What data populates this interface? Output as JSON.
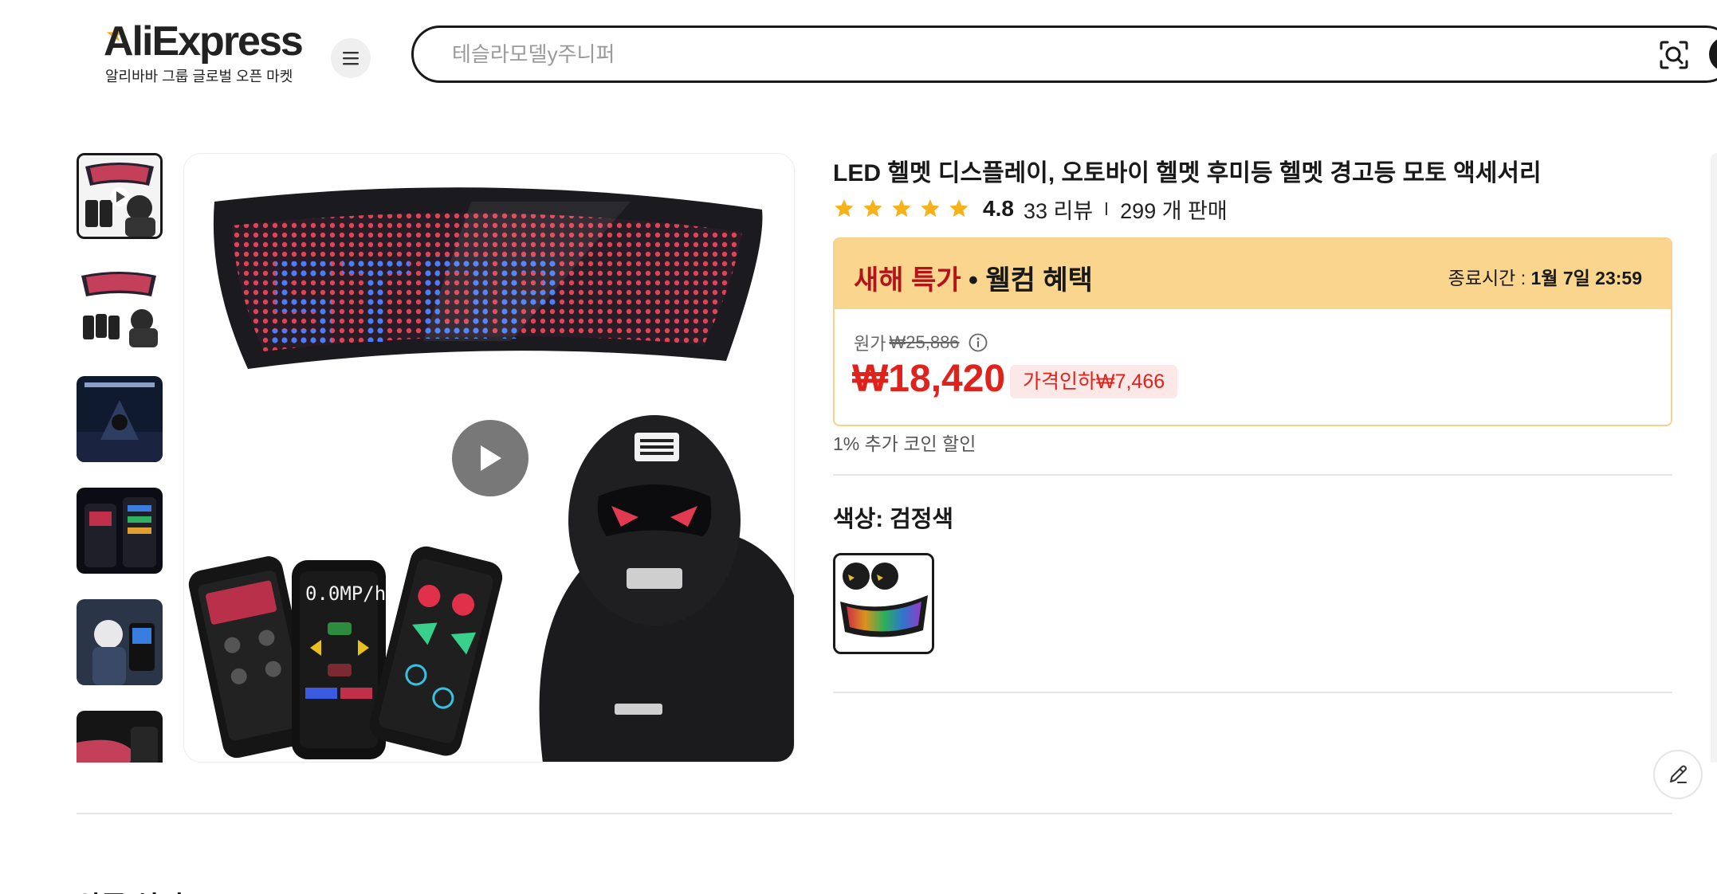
{
  "header": {
    "logo_text": "AliExpress",
    "logo_sub": "알리바바 그룹 글로벌 오픈 마켓",
    "search_placeholder": "테슬라모델y주니퍼",
    "icons": {
      "menu": "hamburger-icon",
      "camera": "image-search-icon"
    }
  },
  "gallery": {
    "thumb_count": 6,
    "selected_index": 0,
    "main_image": "led-helmet-display-product-photo",
    "has_video": true
  },
  "product": {
    "title": "LED 헬멧 디스플레이, 오토바이 헬멧 후미등 헬멧 경고등 모토 액세서리",
    "rating": "4.8",
    "stars": 5,
    "reviews": "33 리뷰",
    "sold": "299 개 판매"
  },
  "promo": {
    "label_red": "새해 특가",
    "label_dot": " • ",
    "label_black": "웰컴 혜택",
    "end_label": "종료시간 : ",
    "end_time": "1월 7일 23:59",
    "original_label": "원가",
    "original_price": "₩25,886",
    "price": "₩18,420",
    "discount": "가격인하₩7,466"
  },
  "coin_text": "1% 추가 코인 할인",
  "color": {
    "label": "색상: 검정색"
  },
  "section_peek": "상품 설명",
  "colors": {
    "accent_red": "#e0221c",
    "promo_bg": "#f9d58e",
    "promo_red": "#b3131b",
    "star": "#f7b21b"
  }
}
